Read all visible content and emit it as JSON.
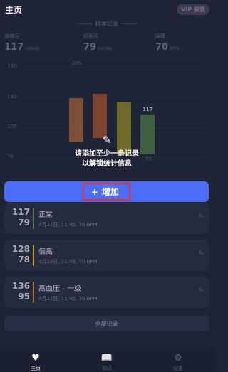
{
  "header": {
    "title": "主页",
    "badge": "VIP 解锁"
  },
  "sample": {
    "label": "样本记录"
  },
  "metrics": [
    {
      "label": "收缩压",
      "value": "117",
      "unit": "mmHg"
    },
    {
      "label": "舒张压",
      "value": "79",
      "unit": "mmHg"
    },
    {
      "label": "脉搏",
      "value": "70",
      "unit": "BPM"
    }
  ],
  "chart_data": {
    "type": "bar",
    "yticks": [
      "160",
      "132",
      "105",
      "78"
    ],
    "top_label": "205",
    "bars": [
      {
        "color": "#8a5a3c"
      },
      {
        "color": "#8a4a3a"
      },
      {
        "color": "#7e7530"
      },
      {
        "color": "#3f6a44",
        "high": "117",
        "low": "79"
      }
    ]
  },
  "overlay": {
    "pencil_icon": "pencil-icon",
    "line1": "请添加至少一条记录",
    "line2": "以解锁统计信息"
  },
  "add_button": {
    "plus": "+",
    "label": "增加"
  },
  "records": [
    {
      "sys": "117",
      "dia": "79",
      "status": "正常",
      "meta": "4月22日, 11:45, 70 BPM",
      "color": "#4a7a4c"
    },
    {
      "sys": "128",
      "dia": "78",
      "status": "偏高",
      "meta": "4月22日, 11:45, 70 BPM",
      "color": "#b8952a"
    },
    {
      "sys": "136",
      "dia": "95",
      "status": "高血压 - 一级",
      "meta": "4月22日, 11:45, 70 BPM",
      "color": "#b86a2a"
    }
  ],
  "all_records": {
    "label": "全部记录"
  },
  "nav": [
    {
      "icon": "♥",
      "label": "主页"
    },
    {
      "icon": "📖",
      "label": "知识"
    },
    {
      "icon": "⚙",
      "label": "设置"
    }
  ]
}
